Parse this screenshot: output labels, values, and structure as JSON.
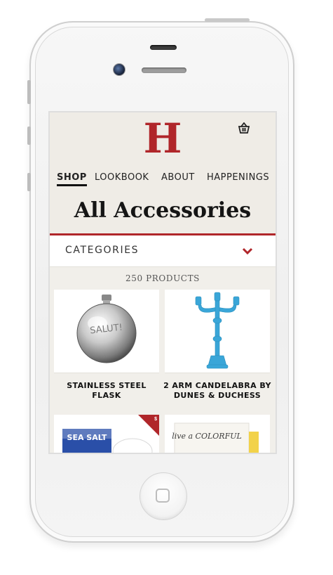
{
  "app": {
    "logo_text": "H",
    "brand_color": "#b0262a"
  },
  "header": {
    "cart_icon": "basket-icon"
  },
  "nav": {
    "items": [
      {
        "label": "SHOP",
        "active": true
      },
      {
        "label": "LOOKBOOK",
        "active": false
      },
      {
        "label": "ABOUT",
        "active": false
      },
      {
        "label": "HAPPENINGS",
        "active": false
      }
    ]
  },
  "page": {
    "title": "All Accessories"
  },
  "filters": {
    "categories_label": "CATEGORIES",
    "dropdown_icon": "chevron-down-icon"
  },
  "results": {
    "count_label": "250 PRODUCTS"
  },
  "products": [
    {
      "name": "STAINLESS STEEL FLASK",
      "engraving": "SALUT!"
    },
    {
      "name": "2 ARM CANDELABRA BY DUNES & DUCHESS"
    },
    {
      "name": "",
      "label_text": "SEA SALT",
      "sale_badge": "$"
    },
    {
      "name": "",
      "label_text": "live a COLORFUL"
    }
  ]
}
